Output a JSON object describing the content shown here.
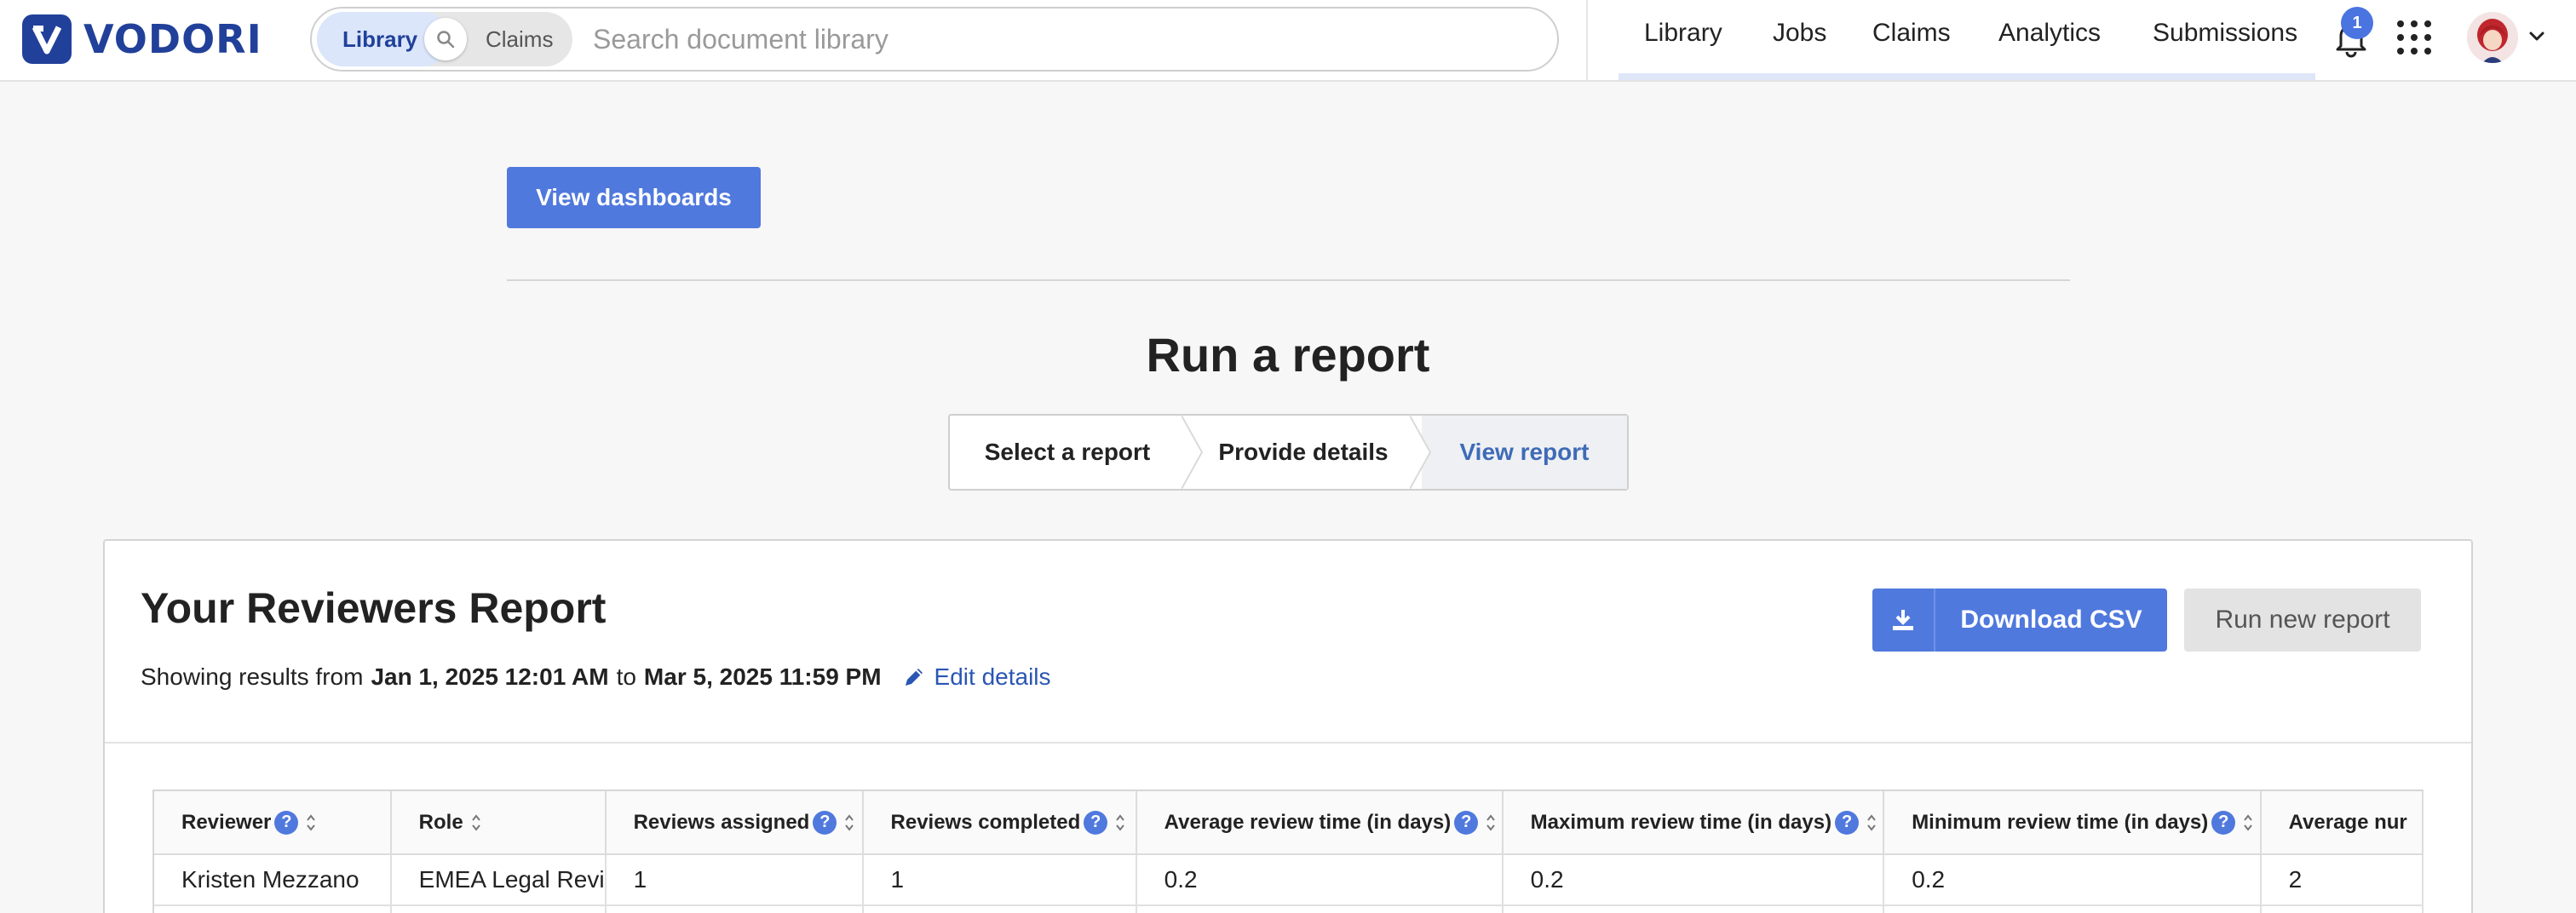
{
  "brand": {
    "name": "VODORI",
    "color": "#21409a"
  },
  "search": {
    "scope_library": "Library",
    "scope_claims": "Claims",
    "placeholder": "Search document library"
  },
  "nav": {
    "items": [
      "Library",
      "Jobs",
      "Claims",
      "Analytics",
      "Submissions"
    ],
    "notification_count": "1"
  },
  "view_dashboards_label": "View dashboards",
  "page_title": "Run a report",
  "steps": [
    {
      "label": "Select a report",
      "state": "done"
    },
    {
      "label": "Provide details",
      "state": "done"
    },
    {
      "label": "View report",
      "state": "active"
    }
  ],
  "report": {
    "title": "Your Reviewers Report",
    "range_prefix": "Showing results from",
    "start": "Jan 1, 2025 12:01 AM",
    "range_to": "to",
    "end": "Mar 5, 2025 11:59 PM",
    "edit_label": "Edit details",
    "download_label": "Download CSV",
    "run_new_label": "Run new report"
  },
  "table": {
    "columns": [
      {
        "label": "Reviewer",
        "help": true
      },
      {
        "label": "Role",
        "help": false
      },
      {
        "label": "Reviews assigned",
        "help": true
      },
      {
        "label": "Reviews completed",
        "help": true
      },
      {
        "label": "Average review time (in days)",
        "help": true
      },
      {
        "label": "Maximum review time (in days)",
        "help": true
      },
      {
        "label": "Minimum review time (in days)",
        "help": true
      },
      {
        "label": "Average nur",
        "help": false
      }
    ],
    "rows": [
      [
        "Kristen Mezzano",
        "EMEA Legal Revi",
        "1",
        "1",
        "0.2",
        "0.2",
        "0.2",
        "2"
      ]
    ]
  },
  "colors": {
    "accent": "#5079de",
    "link": "#2a56b4",
    "step_active": "#3e6bb7"
  }
}
